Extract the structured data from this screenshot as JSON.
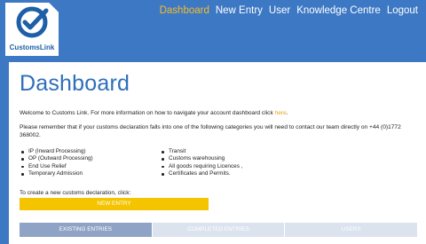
{
  "brand": {
    "name": "CustomsLink",
    "accent": "#3d78c4",
    "highlight": "#f5bb2a"
  },
  "nav": {
    "items": [
      {
        "label": "Dashboard",
        "active": true
      },
      {
        "label": "New Entry",
        "active": false
      },
      {
        "label": "User",
        "active": false
      },
      {
        "label": "Knowledge Centre",
        "active": false
      },
      {
        "label": "Logout",
        "active": false
      }
    ]
  },
  "main": {
    "title": "Dashboard",
    "welcome_text": "Welcome to Customs Link. For more information on how to navigate your account dashboard click ",
    "welcome_link": "here",
    "welcome_end": ".",
    "remember_text": "Please remember that if your customs declaration falls into one of the following categories you will need to contact our team directly on +44 (0)1772 368002.",
    "categories_left": [
      "IP (Inward Processing)",
      "OP (Outward Processing)",
      "End Use Relief",
      "Temporary Admission"
    ],
    "categories_right": [
      "Transit",
      "Customs warehousing",
      "All goods requiring Licences ,",
      "Certificates and Permits."
    ],
    "create_text": "To create a new customs declaration, click:",
    "new_entry_button": "NEW ENTRY"
  },
  "tabs": [
    {
      "label": "EXISTING ENTRIES",
      "active": true
    },
    {
      "label": "COMPLETED ENTRIES",
      "active": false
    },
    {
      "label": "USERS",
      "active": false
    }
  ]
}
